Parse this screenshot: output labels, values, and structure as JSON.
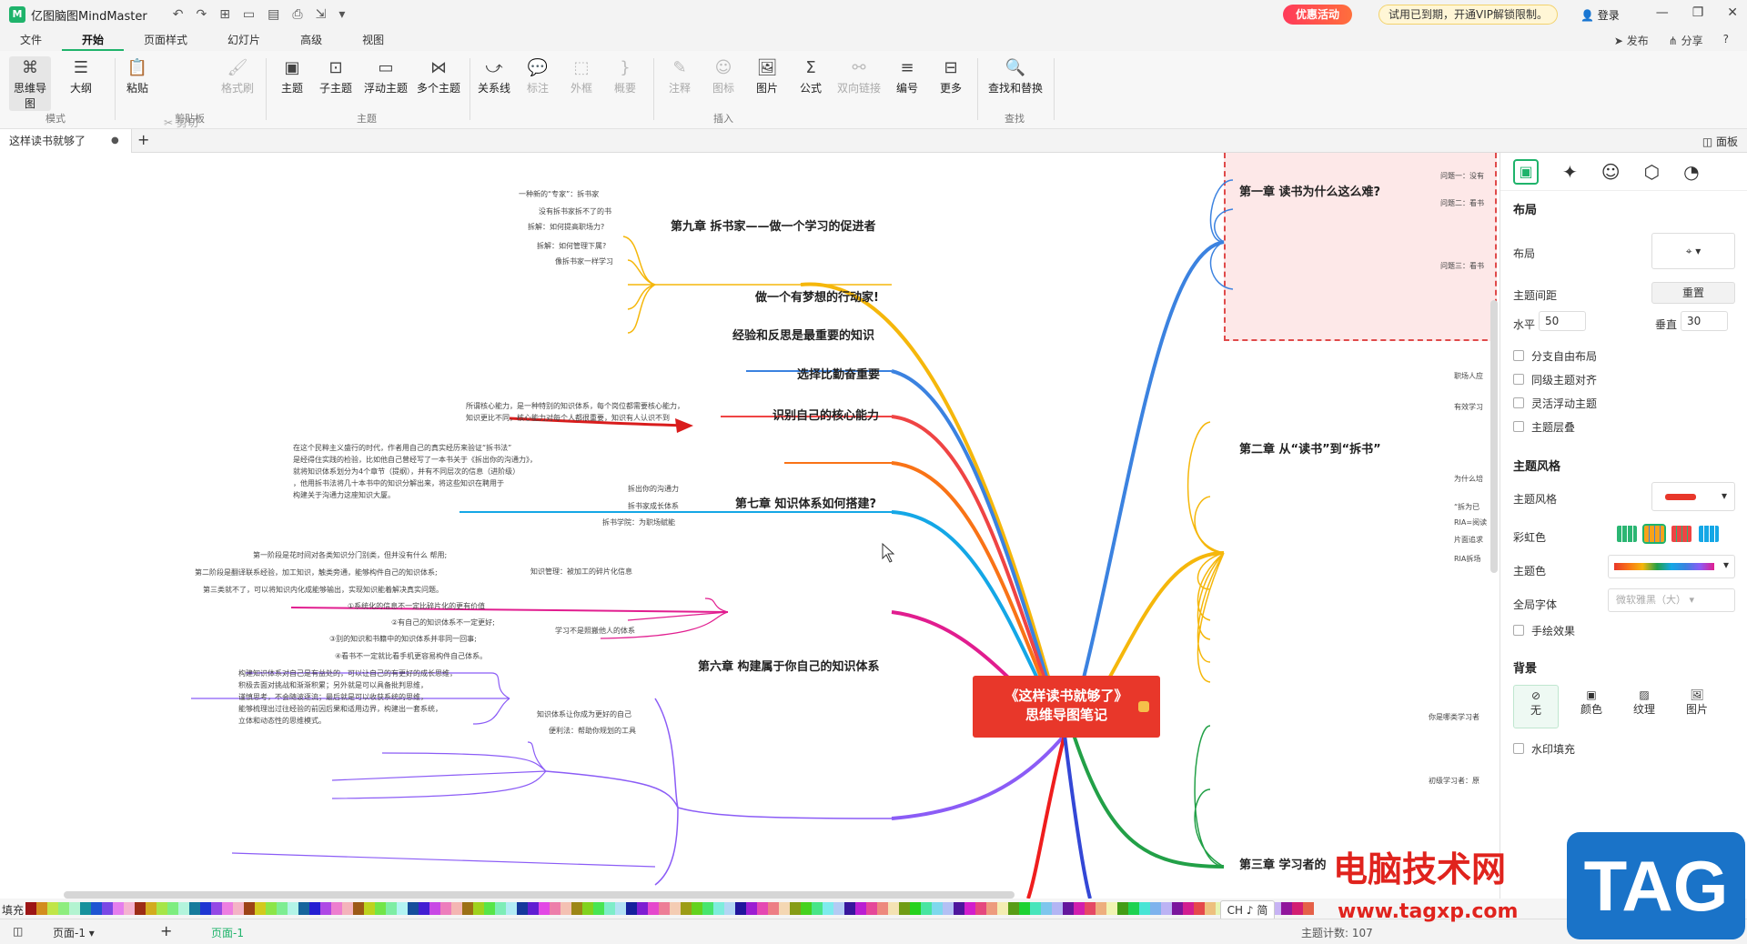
{
  "app": {
    "name": "亿图脑图MindMaster",
    "logo_letter": "M"
  },
  "quick_access": [
    "↶",
    "↷",
    "⊞",
    "▭",
    "▤",
    "⎙",
    "⇲",
    "▾"
  ],
  "promo": {
    "activity": "优惠活动",
    "vip": "试用已到期，开通VIP解锁限制。",
    "login": "登录"
  },
  "window_controls": [
    "—",
    "❐",
    "✕"
  ],
  "menu": {
    "items": [
      "文件",
      "开始",
      "页面样式",
      "幻灯片",
      "高级",
      "视图"
    ],
    "active": "开始",
    "publish": "发布",
    "share": "分享",
    "help": "?"
  },
  "ribbon": {
    "buttons": {
      "mindmap": "思维导图",
      "outline": "大纲",
      "paste": "粘贴",
      "cut": "剪切",
      "copy": "拷贝",
      "format_painter": "格式刷",
      "topic": "主题",
      "subtopic": "子主题",
      "floating": "浮动主题",
      "multi": "多个主题",
      "relation": "关系线",
      "callout": "标注",
      "boundary": "外框",
      "summary": "概要",
      "comment": "注释",
      "icon": "图标",
      "picture": "图片",
      "formula": "公式",
      "link": "双向链接",
      "numbering": "编号",
      "more": "更多",
      "find": "查找和替换"
    },
    "groups": {
      "mode": "模式",
      "clipboard": "剪贴板",
      "topic": "主题",
      "insert": "插入",
      "find": "查找"
    }
  },
  "tabs": {
    "doc": "这样读书就够了",
    "add": "+",
    "panel": "面板"
  },
  "mindmap": {
    "center": {
      "line1": "《这样读书就够了》",
      "line2": "思维导图笔记"
    },
    "chapters": {
      "ch9": "第九章 拆书家——做一个学习的促进者",
      "dream": "做一个有梦想的行动家!",
      "exp": "经验和反思是最重要的知识",
      "choice": "选择比勤奋重要",
      "core": "识别自己的核心能力",
      "ch7": "第七章 知识体系如何搭建?",
      "ch6": "第六章 构建属于你自己的知识体系",
      "ch1": "第一章 读书为什么这么难?",
      "ch2": "第二章 从“读书”到“拆书”",
      "ch3": "第三章 学习者的"
    },
    "ch9_leaves": [
      "一种新的“专家”：拆书家",
      "没有拆书家拆不了的书",
      "拆解：如何提高职场力?",
      "拆解：如何管理下属?",
      "像拆书家一样学习"
    ],
    "core_note": [
      "所谓核心能力，是一种特别的知识体系，每个岗位都需要核心能力，",
      "知识更比不同，核心能力对每个人都很重要，知识有人认识不到"
    ],
    "ch7_note": [
      "在这个民粹主义盛行的时代，作者用自己的真实经历来验证“拆书法”",
      "是经得住实践的检验，比如他自己曾经写了一本书关于《拆出你的沟通力》，",
      "就将知识体系划分为4个章节（提纲），并有不同层次的信息（进阶级）",
      "，他用拆书法将几十本书中的知识分解出来，将这些知识在聘用于",
      "构建关于沟通力这座知识大厦。"
    ],
    "ch7_leaves": [
      "拆出你的沟通力",
      "拆书家成长体系",
      "拆书学院：为职场赋能"
    ],
    "ch6_a_leaves": [
      "第一阶段是花时间对各类知识分门别类，但并没有什么 帮用;",
      "第二阶段是翻译联系经验，加工知识，触类旁通，能够构件自己的知识体系;",
      "第三类就不了，可以将知识内化成能够输出，实现知识能着解决真实问题。"
    ],
    "ch6_a": "知识管理：被加工的碎片化信息",
    "ch6_b_leaves": [
      "①系统化的信息不一定比碎片化的更有价值",
      "②有自己的知识体系不一定更好;",
      "③别的知识和书籍中的知识体系并非同一回事;",
      "④看书不一定就比看手机更容易构件自己体系。"
    ],
    "ch6_b": "学习不是照搬他人的体系",
    "ch6_c_note": [
      "构建知识体系对自己是有益处的，可以让自己的有更好的成长思维，",
      "积极去面对挑战和渐渐积累；另外就是可以具备批判思维，",
      "谨慎思考，不会随波逐流；最后就是可以收获系统的思维，",
      "能够梳理出过往经验的前因后果和适用边界，构建出一套系统，",
      "立体和动态性的思维模式。"
    ],
    "ch6_c": "知识体系让你成为更好的自己",
    "ch6_d": "便利法：帮助你规划的工具",
    "ch1_leaves": [
      "问题一：没有",
      "问题二：看书",
      "问题三：看书"
    ],
    "ch2_leaves": [
      "职场人应",
      "有效学习",
      "为什么培",
      "“拆为已",
      "RIA=阅读",
      "片面追求",
      "RIA拆场"
    ],
    "ch3_leaves": [
      "你是哪类学习者",
      "初级学习者：原"
    ]
  },
  "side": {
    "layout_h": "布局",
    "layout": "布局",
    "spacing": "主题间距",
    "reset": "重置",
    "horizontal": "水平",
    "h_val": "50",
    "vertical": "垂直",
    "v_val": "30",
    "checks": [
      "分支自由布局",
      "同级主题对齐",
      "灵活浮动主题",
      "主题层叠"
    ],
    "style_h": "主题风格",
    "style": "主题风格",
    "rainbow": "彩虹色",
    "theme_color": "主题色",
    "font": "全局字体",
    "font_val": "微软雅黑（大）",
    "hand": "手绘效果",
    "bg_h": "背景",
    "bg_opts": [
      "无",
      "颜色",
      "纹理",
      "图片"
    ],
    "watermark": "水印填充"
  },
  "colorbar": {
    "fill": "填充"
  },
  "status": {
    "page_left": "页面-1",
    "page_active": "页面-1",
    "add": "+",
    "count_label": "主题计数:",
    "count": "107"
  },
  "ime": "CH ♪ 简",
  "watermark": {
    "text": "电脑技术网",
    "url": "www.tagxp.com",
    "tag": "TAG"
  },
  "colors": {
    "green": "#1fb36b",
    "red": "#e8372a"
  }
}
